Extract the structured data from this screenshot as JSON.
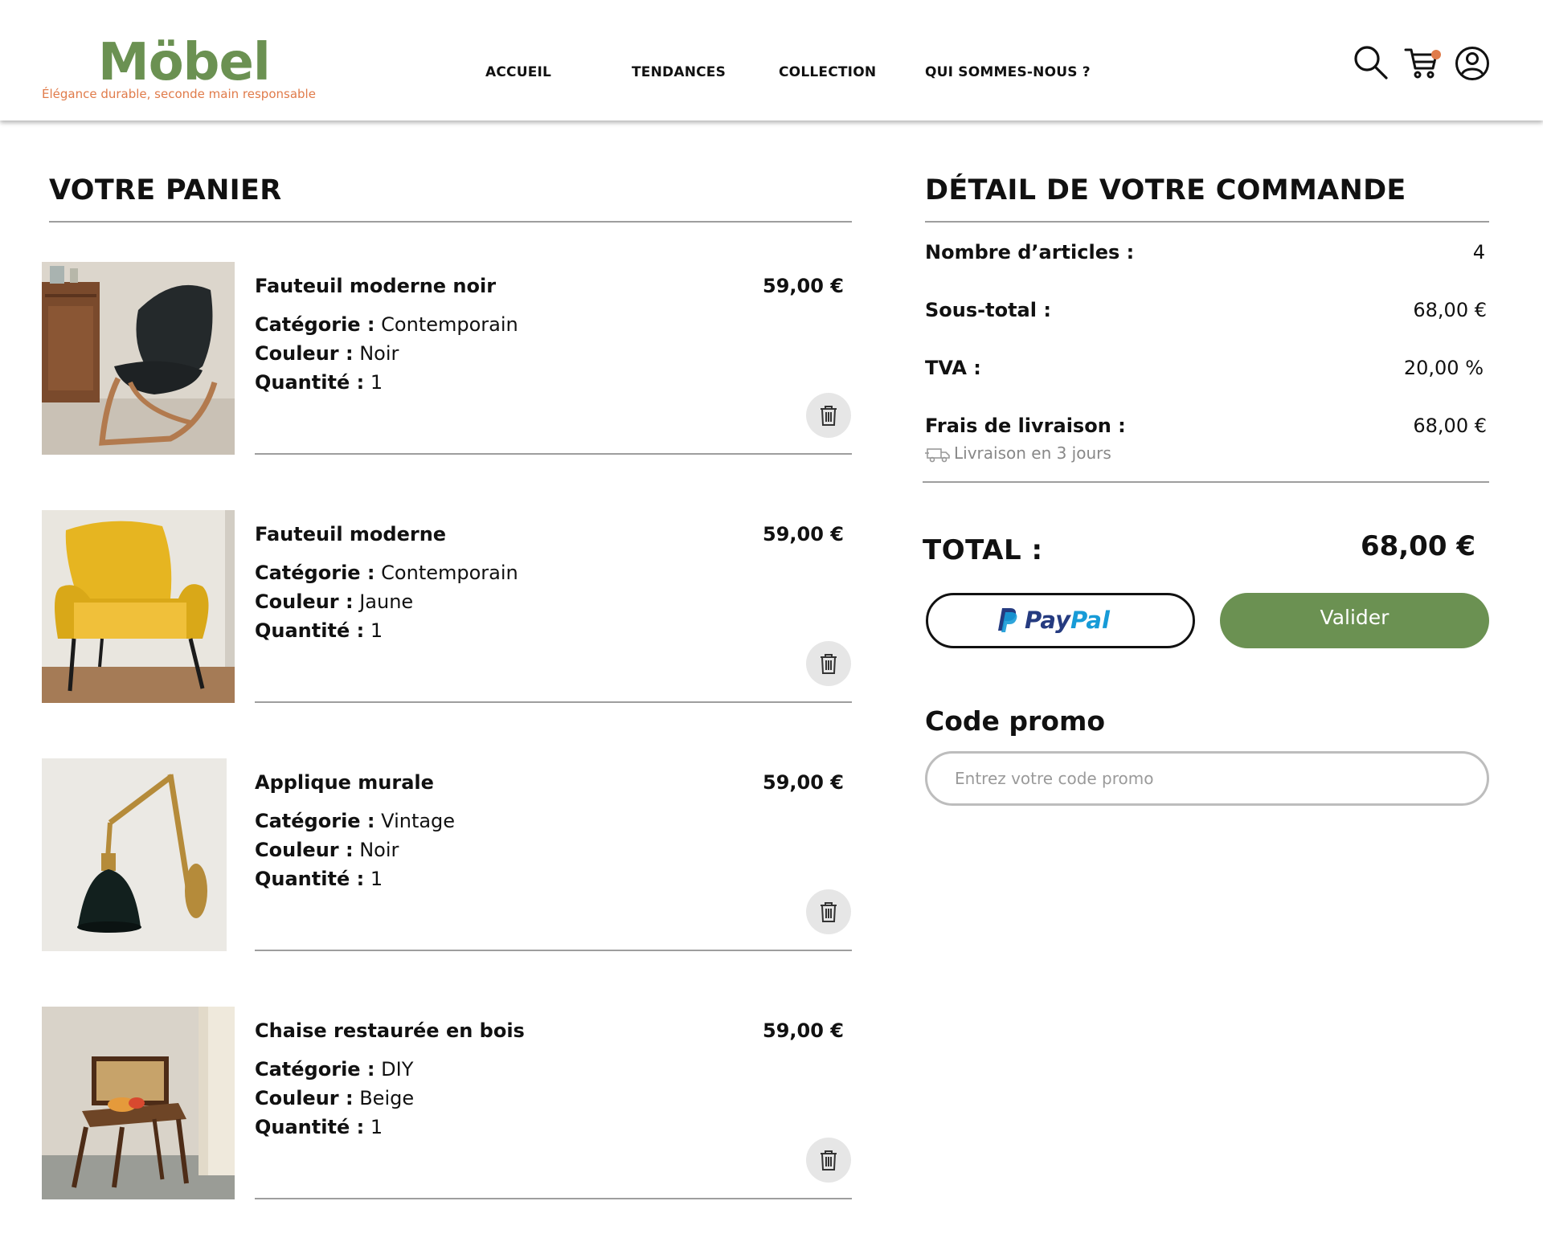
{
  "brand": {
    "name": "Möbel",
    "tagline": "Élégance durable, seconde main responsable",
    "green": "#6b9152",
    "orange": "#e07b4a"
  },
  "nav": {
    "items": [
      "ACCUEIL",
      "TENDANCES",
      "COLLECTION",
      "QUI SOMMES-NOUS ?"
    ]
  },
  "header_icons": [
    "search-icon",
    "cart-icon",
    "user-icon"
  ],
  "cart": {
    "title": "VOTRE PANIER",
    "labels": {
      "category": "Catégorie :",
      "color": "Couleur :",
      "quantity": "Quantité :"
    },
    "items": [
      {
        "name": "Fauteuil moderne noir",
        "price": "59,00 €",
        "category": "Contemporain",
        "color": "Noir",
        "quantity": "1"
      },
      {
        "name": "Fauteuil moderne",
        "price": "59,00 €",
        "category": "Contemporain",
        "color": "Jaune",
        "quantity": "1"
      },
      {
        "name": "Applique murale",
        "price": "59,00 €",
        "category": "Vintage",
        "color": "Noir",
        "quantity": "1"
      },
      {
        "name": "Chaise restaurée en bois",
        "price": "59,00 €",
        "category": "DIY",
        "color": "Beige",
        "quantity": "1"
      }
    ]
  },
  "order": {
    "title": "DÉTAIL DE VOTRE COMMANDE",
    "article_count_label": "Nombre d’articles :",
    "article_count": "4",
    "subtotal_label": "Sous-total :",
    "subtotal": "68,00 €",
    "vat_label": "TVA :",
    "vat": "20,00 %",
    "shipping_label": "Frais de livraison :",
    "shipping": "68,00 €",
    "delivery_note": "Livraison en 3 jours",
    "total_label": "TOTAL :",
    "total": "68,00 €",
    "paypal_pay": "Pay",
    "paypal_pal": "Pal",
    "validate_label": "Valider"
  },
  "promo": {
    "title": "Code promo",
    "placeholder": "Entrez votre code promo"
  }
}
